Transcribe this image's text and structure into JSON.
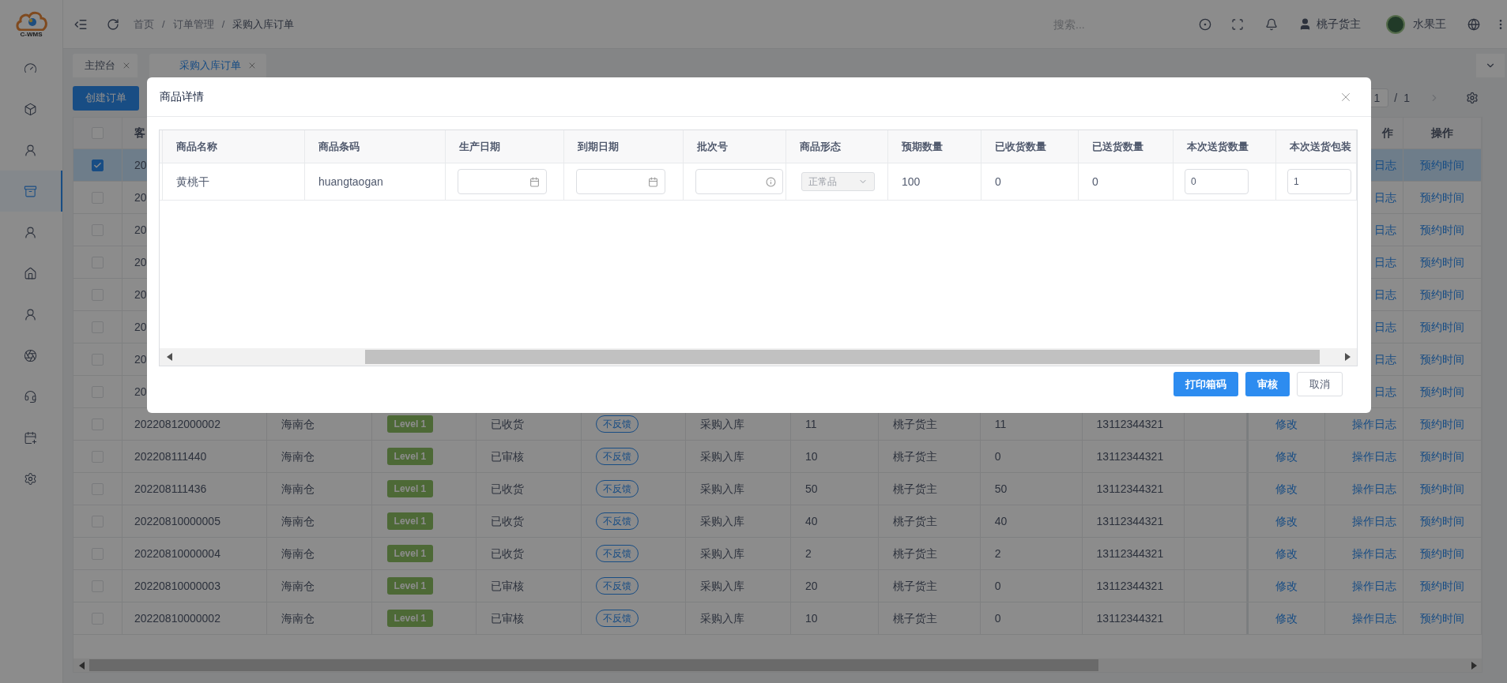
{
  "logo": {
    "text": "C-WMS"
  },
  "sidebar": {
    "items": [
      {
        "selected": false
      },
      {
        "selected": false
      },
      {
        "selected": false
      },
      {
        "selected": true
      },
      {
        "selected": false
      },
      {
        "selected": false
      },
      {
        "selected": false
      },
      {
        "selected": false
      },
      {
        "selected": false
      },
      {
        "selected": false
      },
      {
        "selected": false
      }
    ]
  },
  "header": {
    "breadcrumb": [
      "首页",
      "订单管理",
      "采购入库订单"
    ],
    "breadcrumb_separator": "/",
    "search": {
      "placeholder": "搜索..."
    },
    "user": "桃子货主",
    "organization": "水果王"
  },
  "tabs": [
    {
      "label": "主控台",
      "selected": false
    },
    {
      "label": "采购入库订单",
      "selected": true
    }
  ],
  "toolbar": {
    "create_button": "创建订单",
    "pager": {
      "page": "1",
      "separator": "/",
      "total": "1"
    }
  },
  "table": {
    "header": {
      "checked": false,
      "order_no": "客",
      "log": "作",
      "reserve": "操作"
    },
    "rows": [
      {
        "checked": true,
        "selected": true,
        "order_no": "20",
        "log": "日志",
        "reserve": "预约时间"
      },
      {
        "checked": false,
        "selected": false,
        "order_no": "20",
        "log": "日志",
        "reserve": "预约时间"
      },
      {
        "checked": false,
        "selected": false,
        "order_no": "20",
        "log": "日志",
        "reserve": "预约时间"
      },
      {
        "checked": false,
        "selected": false,
        "order_no": "20",
        "log": "日志",
        "reserve": "预约时间"
      },
      {
        "checked": false,
        "selected": false,
        "order_no": "20",
        "log": "日志",
        "reserve": "预约时间"
      },
      {
        "checked": false,
        "selected": false,
        "order_no": "20",
        "log": "日志",
        "reserve": "预约时间"
      },
      {
        "checked": false,
        "selected": false,
        "order_no": "20",
        "log": "日志",
        "reserve": "预约时间"
      },
      {
        "checked": false,
        "selected": false,
        "order_no": "20",
        "log": "日志",
        "reserve": "预约时间"
      },
      {
        "checked": false,
        "selected": false,
        "order_no": "20220812000002",
        "warehouse": "海南仓",
        "level": "Level 1",
        "status": "已收货",
        "feedback": "不反馈",
        "type": "采购入库",
        "qty": "11",
        "owner": "桃子货主",
        "received": "11",
        "phone": "13112344321",
        "edit": "修改",
        "log": "操作日志",
        "reserve": "预约时间"
      },
      {
        "checked": false,
        "selected": false,
        "order_no": "202208111440",
        "warehouse": "海南仓",
        "level": "Level 1",
        "status": "已审核",
        "feedback": "不反馈",
        "type": "采购入库",
        "qty": "10",
        "owner": "桃子货主",
        "received": "0",
        "phone": "13112344321",
        "edit": "修改",
        "log": "操作日志",
        "reserve": "预约时间"
      },
      {
        "checked": false,
        "selected": false,
        "order_no": "202208111436",
        "warehouse": "海南仓",
        "level": "Level 1",
        "status": "已收货",
        "feedback": "不反馈",
        "type": "采购入库",
        "qty": "50",
        "owner": "桃子货主",
        "received": "50",
        "phone": "13112344321",
        "edit": "修改",
        "log": "操作日志",
        "reserve": "预约时间"
      },
      {
        "checked": false,
        "selected": false,
        "order_no": "20220810000005",
        "warehouse": "海南仓",
        "level": "Level 1",
        "status": "已收货",
        "feedback": "不反馈",
        "type": "采购入库",
        "qty": "40",
        "owner": "桃子货主",
        "received": "40",
        "phone": "13112344321",
        "edit": "修改",
        "log": "操作日志",
        "reserve": "预约时间"
      },
      {
        "checked": false,
        "selected": false,
        "order_no": "20220810000004",
        "warehouse": "海南仓",
        "level": "Level 1",
        "status": "已收货",
        "feedback": "不反馈",
        "type": "采购入库",
        "qty": "2",
        "owner": "桃子货主",
        "received": "2",
        "phone": "13112344321",
        "edit": "修改",
        "log": "操作日志",
        "reserve": "预约时间"
      },
      {
        "checked": false,
        "selected": false,
        "order_no": "20220810000003",
        "warehouse": "海南仓",
        "level": "Level 1",
        "status": "已审核",
        "feedback": "不反馈",
        "type": "采购入库",
        "qty": "20",
        "owner": "桃子货主",
        "received": "0",
        "phone": "13112344321",
        "edit": "修改",
        "log": "操作日志",
        "reserve": "预约时间"
      },
      {
        "checked": false,
        "selected": false,
        "order_no": "20220810000002",
        "warehouse": "海南仓",
        "level": "Level 1",
        "status": "已审核",
        "feedback": "不反馈",
        "type": "采购入库",
        "qty": "10",
        "owner": "桃子货主",
        "received": "0",
        "phone": "13112344321",
        "edit": "修改",
        "log": "操作日志",
        "reserve": "预约时间"
      }
    ]
  },
  "dialog": {
    "title": "商品详情",
    "columns": [
      "商品名称",
      "商品条码",
      "生产日期",
      "到期日期",
      "批次号",
      "商品形态",
      "预期数量",
      "已收货数量",
      "已送货数量",
      "本次送货数量",
      "本次送货包装"
    ],
    "rows": [
      {
        "cells": [
          {
            "kind": "text",
            "text": "黄桃干"
          },
          {
            "kind": "text",
            "text": "huangtaogan"
          },
          {
            "kind": "date"
          },
          {
            "kind": "date"
          },
          {
            "kind": "batch"
          },
          {
            "kind": "select",
            "value": "正常品",
            "disabled": true
          },
          {
            "kind": "text",
            "text": "100"
          },
          {
            "kind": "text",
            "text": "0"
          },
          {
            "kind": "text",
            "text": "0"
          },
          {
            "kind": "input",
            "value": "0"
          },
          {
            "kind": "input",
            "value": "1"
          }
        ]
      }
    ],
    "buttons": [
      {
        "label": "打印箱码",
        "kind": "primary"
      },
      {
        "label": "审核",
        "kind": "primary"
      },
      {
        "label": "取消",
        "kind": "default"
      }
    ]
  }
}
